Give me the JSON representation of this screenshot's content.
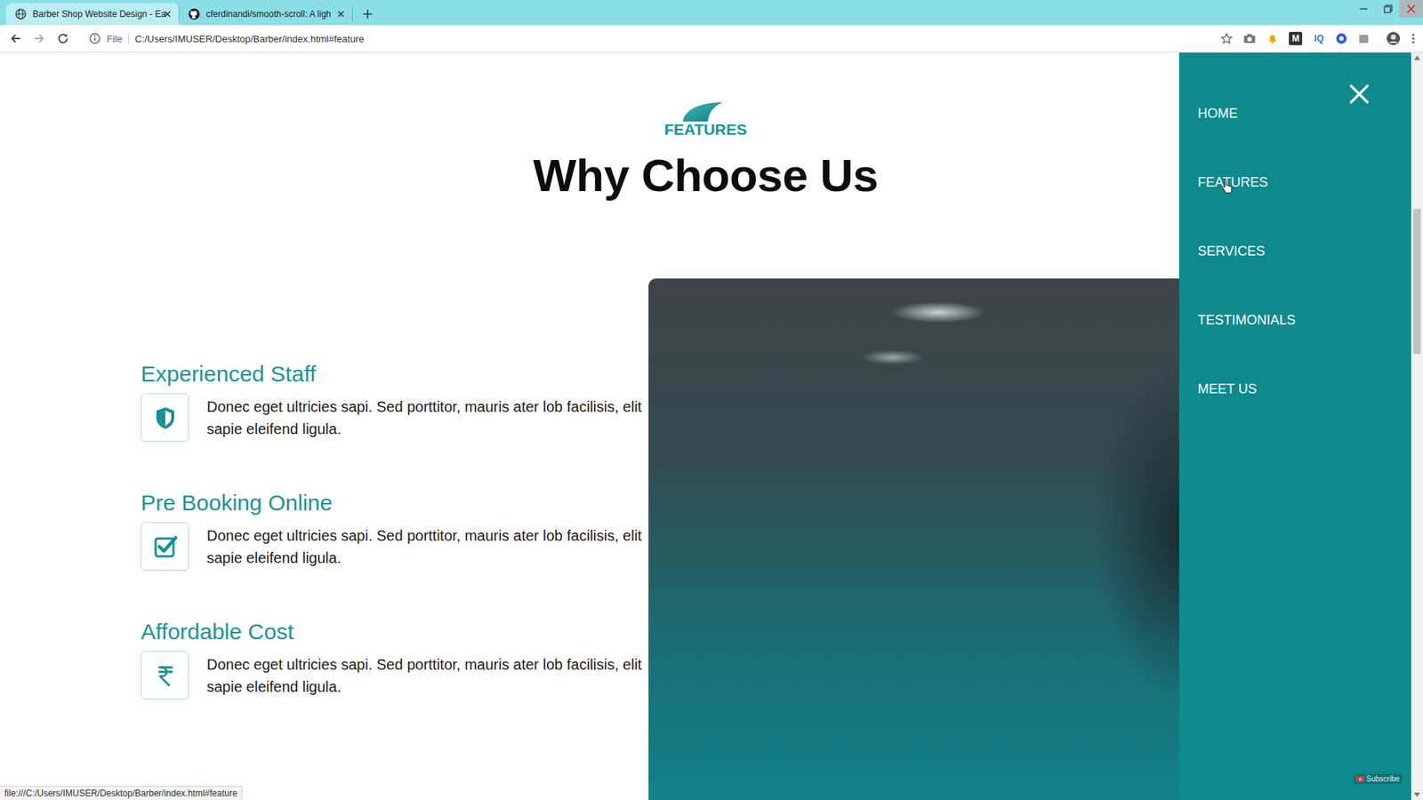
{
  "tabs": [
    {
      "label": "Barber Shop Website Design - Ea",
      "selected": true,
      "kind": "globe"
    },
    {
      "label": "cferdinandi/smooth-scroll: A ligh",
      "selected": false,
      "kind": "github"
    }
  ],
  "address_bar": {
    "scheme": "File",
    "url": "C:/Users/IMUSER/Desktop/Barber/index.html#feature"
  },
  "extensions": [
    {
      "label": "M",
      "kind": "box"
    },
    {
      "label": "IQ",
      "kind": "plain"
    }
  ],
  "section": {
    "tag": "FEATURES",
    "heading": "Why Choose Us"
  },
  "features": [
    {
      "title": "Experienced Staff",
      "text": "Donec eget ultricies sapi. Sed porttitor, mauris ater lob facilisis, elit sapie eleifend ligula.",
      "kind": "shield"
    },
    {
      "title": "Pre Booking Online",
      "text": "Donec eget ultricies sapi. Sed porttitor, mauris ater lob facilisis, elit sapie eleifend ligula.",
      "kind": "check"
    },
    {
      "title": "Affordable Cost",
      "text": "Donec eget ultricies sapi. Sed porttitor, mauris ater lob facilisis, elit sapie eleifend ligula.",
      "kind": "rupee"
    }
  ],
  "side_nav": {
    "open": true,
    "items": [
      {
        "label": "HOME",
        "hovered": false
      },
      {
        "label": "FEATURES",
        "hovered": true
      },
      {
        "label": "SERVICES",
        "hovered": false
      },
      {
        "label": "TESTIMONIALS",
        "hovered": false
      },
      {
        "label": "MEET US",
        "hovered": false
      }
    ]
  },
  "status_bar": {
    "url": "file:///C:/Users/IMUSER/Desktop/Barber/index.html#feature"
  },
  "watermark": {
    "label": "Subscribe"
  }
}
